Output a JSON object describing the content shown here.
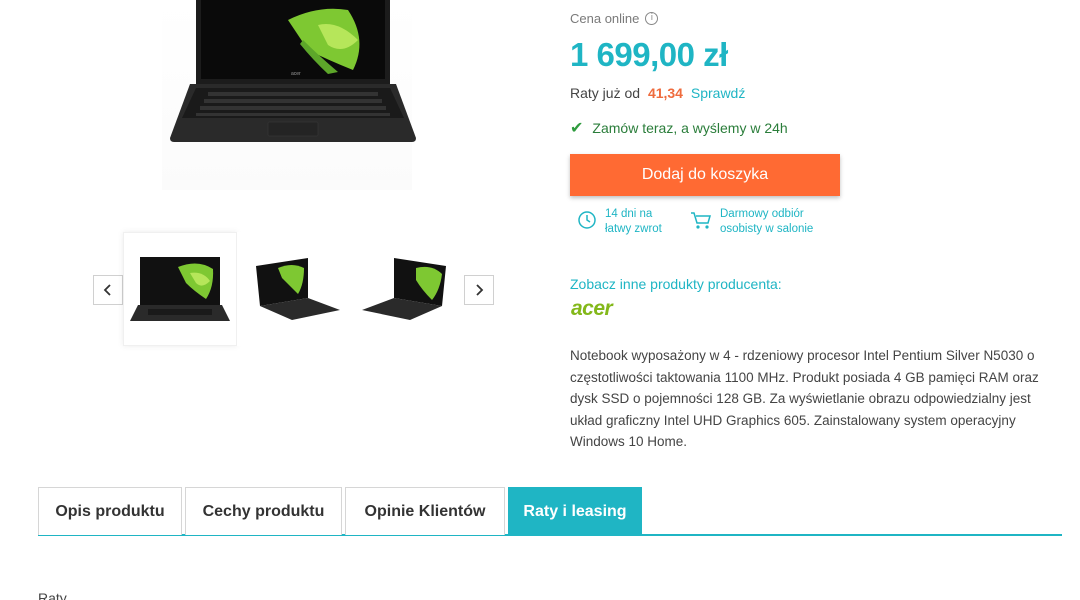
{
  "product": {
    "price_label": "Cena online",
    "price": "1 699,00 zł",
    "installments_prefix": "Raty już od",
    "installments_amount": "41,34",
    "installments_link": "Sprawdź",
    "shipping_note": "Zamów teraz, a wyślemy w 24h",
    "add_to_cart": "Dodaj do koszyka",
    "perks": [
      {
        "icon": "clock-return-icon",
        "line1": "14 dni na",
        "line2": "łatwy zwrot"
      },
      {
        "icon": "cart-pickup-icon",
        "line1": "Darmowy odbiór",
        "line2": "osobisty w salonie"
      }
    ],
    "producer_label": "Zobacz inne produkty producenta:",
    "brand": "acer",
    "description": "Notebook wyposażony w 4 - rdzeniowy procesor Intel Pentium Silver N5030 o częstotliwości taktowania 1100 MHz. Produkt posiada 4 GB pamięci RAM oraz dysk SSD o pojemności 128 GB. Za wyświetlanie obrazu odpowiedzialny jest układ graficzny Intel UHD Graphics 605. Zainstalowany system operacyjny Windows 10 Home."
  },
  "gallery": {
    "thumbnails": [
      "laptop-front",
      "laptop-angle-left",
      "laptop-angle-right"
    ],
    "active_index": 0
  },
  "tabs": [
    {
      "label": "Opis produktu",
      "active": false
    },
    {
      "label": "Cechy produktu",
      "active": false
    },
    {
      "label": "Opinie Klientów",
      "active": false
    },
    {
      "label": "Raty i leasing",
      "active": true
    }
  ],
  "section_heading": "Raty",
  "colors": {
    "accent": "#1fb5c4",
    "cta": "#ff6a33",
    "installments": "#ef6b3d",
    "success": "#2e9b3e"
  }
}
